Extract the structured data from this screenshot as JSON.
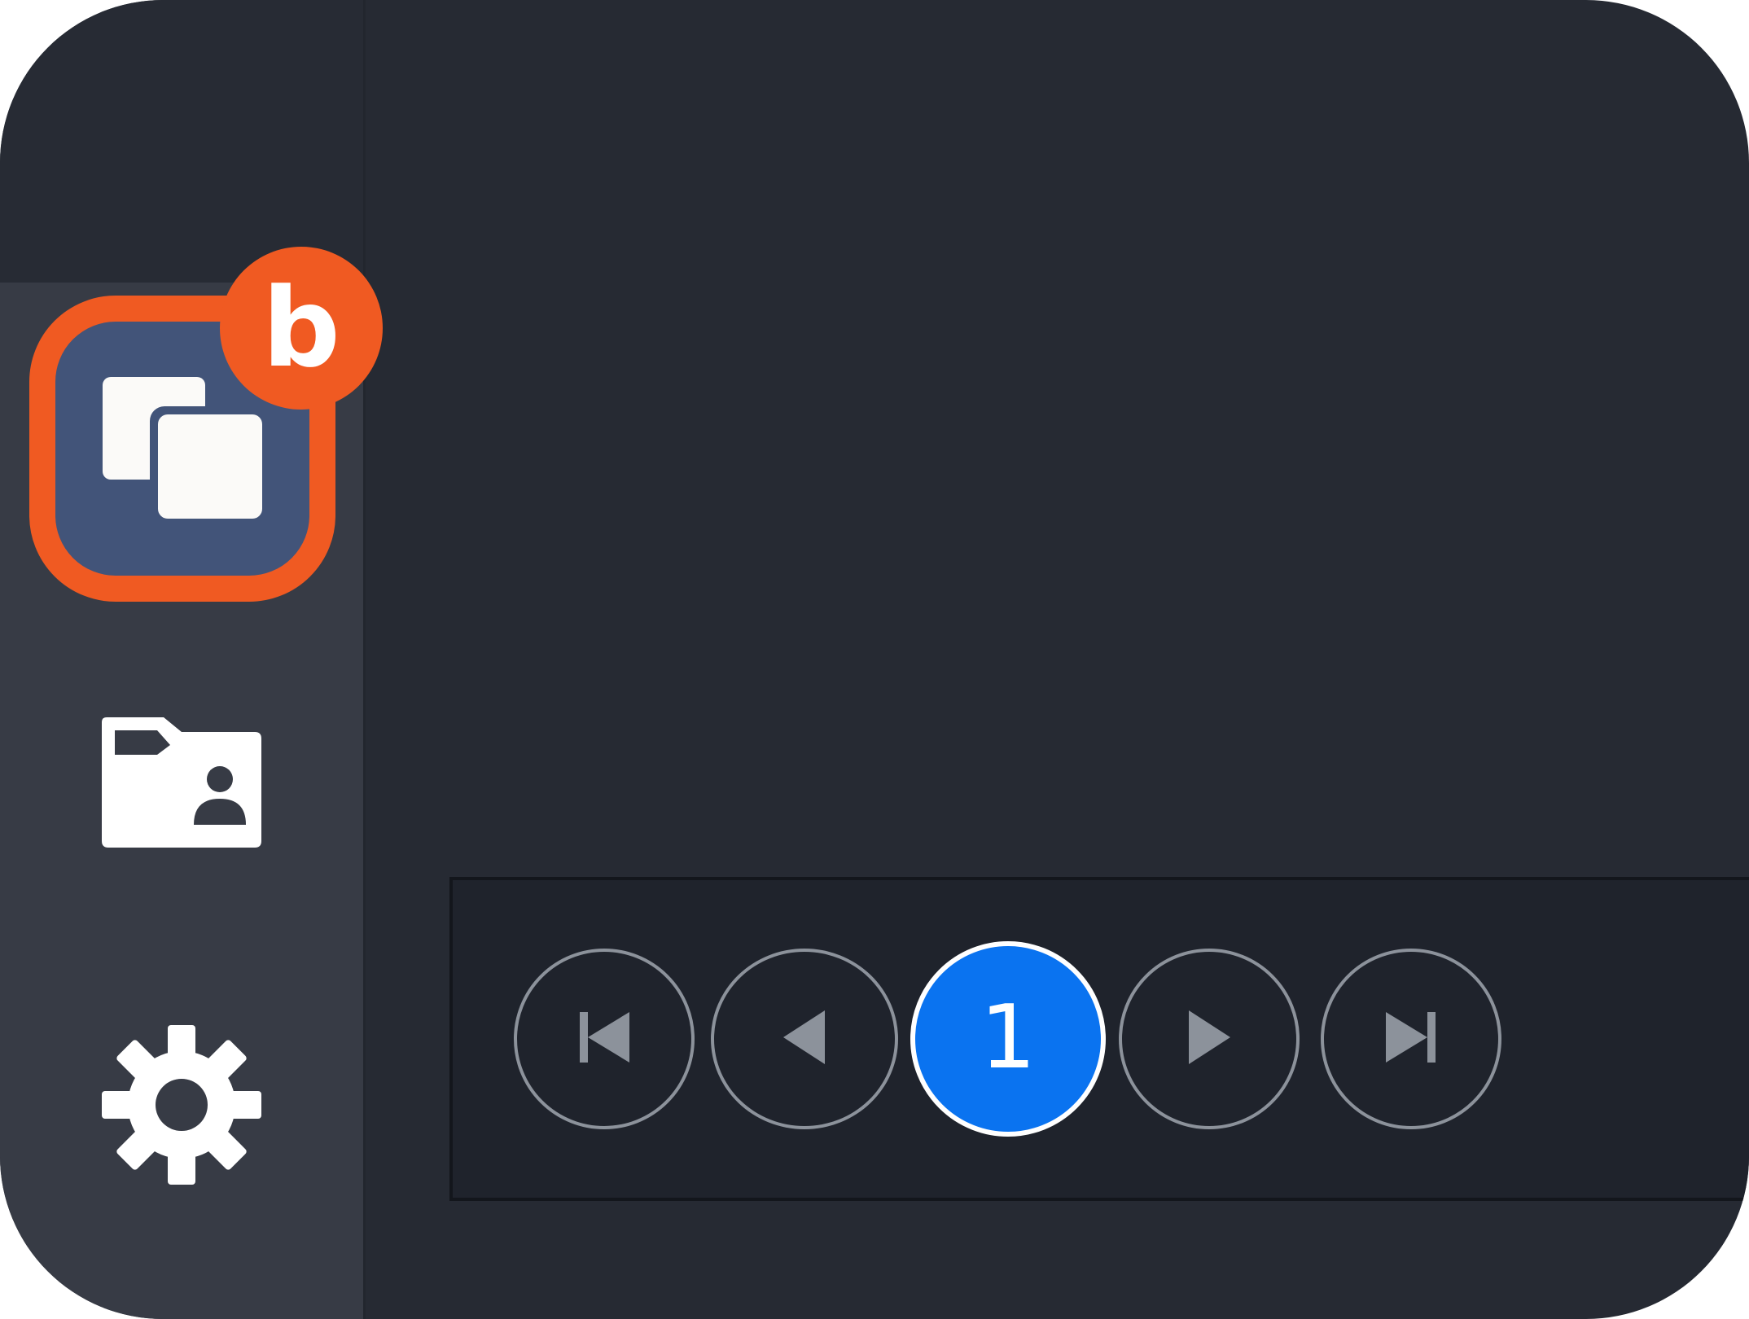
{
  "annotation": {
    "badge_label": "b"
  },
  "sidebar": {
    "items": [
      {
        "name": "duplicate",
        "icon": "copy-icon",
        "active": true
      },
      {
        "name": "shared-folder",
        "icon": "shared-folder-icon",
        "active": false
      },
      {
        "name": "settings",
        "icon": "gear-icon",
        "active": false
      }
    ]
  },
  "pagination": {
    "current_page": "1",
    "buttons": [
      "first-page-icon",
      "previous-page-icon",
      "next-page-icon",
      "last-page-icon"
    ]
  },
  "colors": {
    "background": "#262a33",
    "sidebar": "#373b45",
    "active_item": "#425479",
    "highlight": "#f05a22",
    "current_page": "#0a73f0",
    "pager_icon": "#8c929b"
  }
}
